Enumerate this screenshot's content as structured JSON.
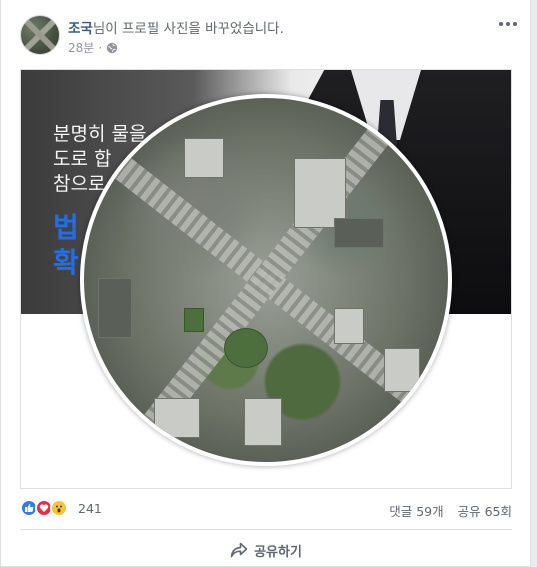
{
  "post": {
    "author": "조국",
    "action": "님이 프로필 사진을 바꾸었습니다.",
    "time": "28분",
    "separator": "·",
    "privacy_icon": "globe-icon",
    "more_icon": "more-icon"
  },
  "cover_text": {
    "lines": [
      "분명히 물을",
      "도로 합",
      "참으로"
    ],
    "blue_lines": [
      "법",
      "확"
    ]
  },
  "stats": {
    "reaction_icons": [
      "like-icon",
      "love-icon",
      "wow-icon"
    ],
    "reaction_count": "241",
    "comments": "댓글 59개",
    "shares": "공유 65회"
  },
  "actions": {
    "share_label": "공유하기",
    "share_icon": "share-arrow-icon"
  },
  "colors": {
    "author_link": "#385898",
    "like": "#2e7bf2",
    "love": "#f0284a",
    "wow": "#f7c531"
  }
}
